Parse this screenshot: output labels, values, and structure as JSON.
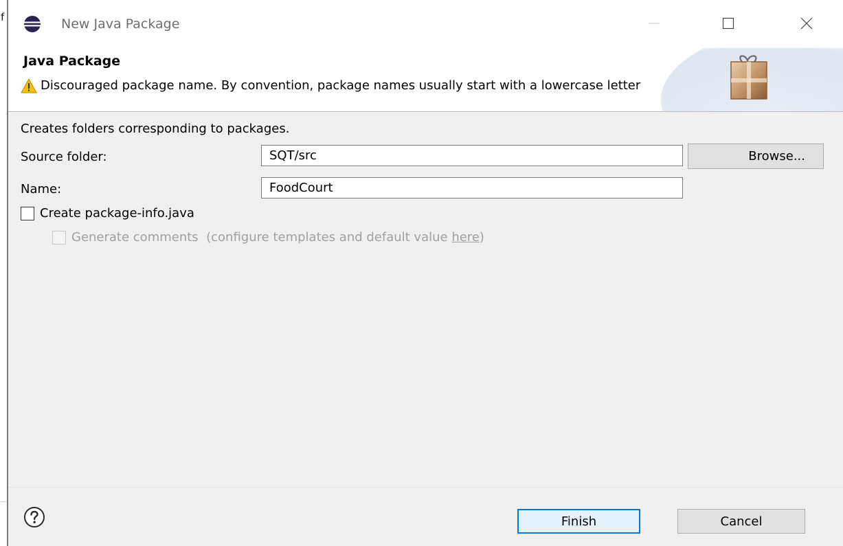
{
  "window": {
    "title": "New Java Package",
    "edge_char": "f"
  },
  "header": {
    "title": "Java Package",
    "message": "Discouraged package name. By convention, package names usually start with a lowercase letter"
  },
  "body": {
    "description": "Creates folders corresponding to packages.",
    "source_folder": {
      "label": "Source folder:",
      "value": "SQT/src",
      "browse_label": "Browse..."
    },
    "name": {
      "label": "Name:",
      "value": "FoodCourt"
    },
    "package_info": {
      "label": "Create package-info.java",
      "checked": false
    },
    "generate_comments": {
      "label": "Generate comments  (configure templates and default value ",
      "link": "here",
      "suffix": ")",
      "checked": false,
      "enabled": false
    }
  },
  "footer": {
    "finish_label": "Finish",
    "cancel_label": "Cancel"
  },
  "icons": {
    "app": "eclipse-icon",
    "warning": "warning-icon",
    "banner": "package-gift-icon",
    "help": "help-icon"
  },
  "colors": {
    "focus_border": "#0078d7",
    "warning_fill": "#f2c200",
    "package_brown": "#b8885a"
  }
}
